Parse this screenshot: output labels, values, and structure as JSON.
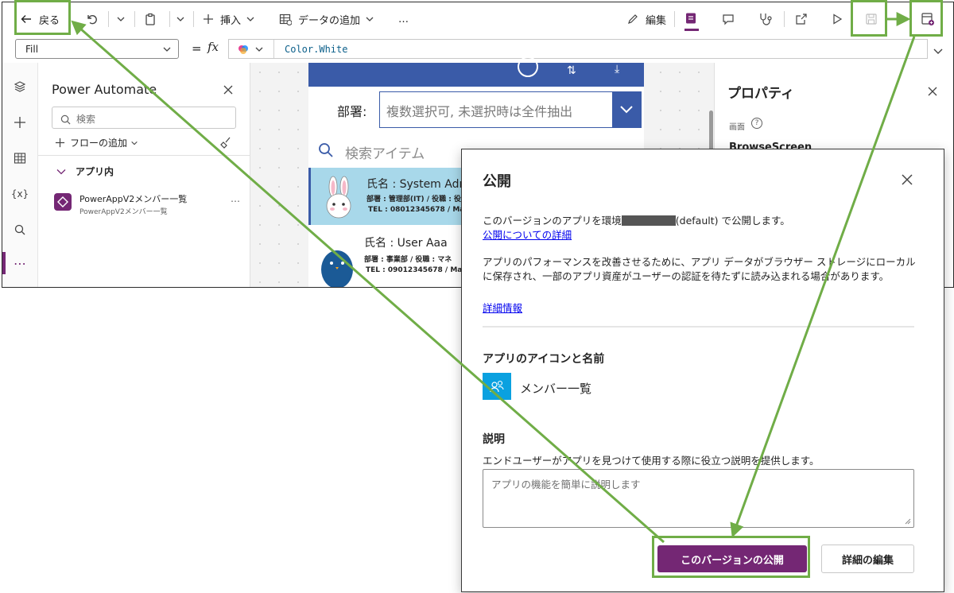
{
  "toolbar": {
    "back": "戻る",
    "insert": "挿入",
    "add_data": "データの追加",
    "more": "…",
    "edit": "編集"
  },
  "formula_bar": {
    "property": "Fill",
    "equals": "=",
    "fx": "fx",
    "formula": "Color.White"
  },
  "power_automate_panel": {
    "title": "Power Automate",
    "search_placeholder": "検索",
    "add_flow": "フローの追加",
    "section": "アプリ内",
    "flow_name": "PowerAppV2メンバー一覧",
    "flow_sub": "PowerAppV2メンバー一覧",
    "flow_more": "…"
  },
  "app_preview": {
    "dept_label": "部署:",
    "dept_placeholder": "複数選択可, 未選択時は全件抽出",
    "search_placeholder": "検索アイテム",
    "items": [
      {
        "name": "氏名 : System Adm",
        "line2": "部署 : 管理部(IT) / 役職 : 役",
        "line3": "TEL : 08012345678 / Mai"
      },
      {
        "name": "氏名 : User Aaa",
        "line2": "部署 : 事業部 / 役職 : マネ",
        "line3": "TEL : 09012345678 / Mai"
      }
    ]
  },
  "properties": {
    "title": "プロパティ",
    "screen_label": "画面",
    "screen_name": "BrowseScreen"
  },
  "dialog": {
    "title": "公開",
    "line1_pre": "このバージョンのアプリを環境",
    "line1_post": "(default) で公開します。",
    "link1": "公開についての詳細",
    "para2": "アプリのパフォーマンスを改善させるために、アプリ データがブラウザー ストレージにローカルに保存され、一部のアプリ資産がユーザーの認証を待たずに読み込まれる場合があります。",
    "link2": "詳細情報",
    "icon_section": "アプリのアイコンと名前",
    "app_name": "メンバー一覧",
    "desc_title": "説明",
    "desc_help": "エンドユーザーがアプリを見つけて使用する際に役立つ説明を提供します。",
    "desc_placeholder": "アプリの機能を簡単に説明します",
    "publish_button": "このバージョンの公開",
    "edit_button": "詳細の編集"
  },
  "colors": {
    "accent": "#742774",
    "app_header": "#3a5ba8",
    "selected_row": "#a8d8ea",
    "highlight": "#70ad47",
    "app_icon_bg": "#0aa1e0"
  }
}
